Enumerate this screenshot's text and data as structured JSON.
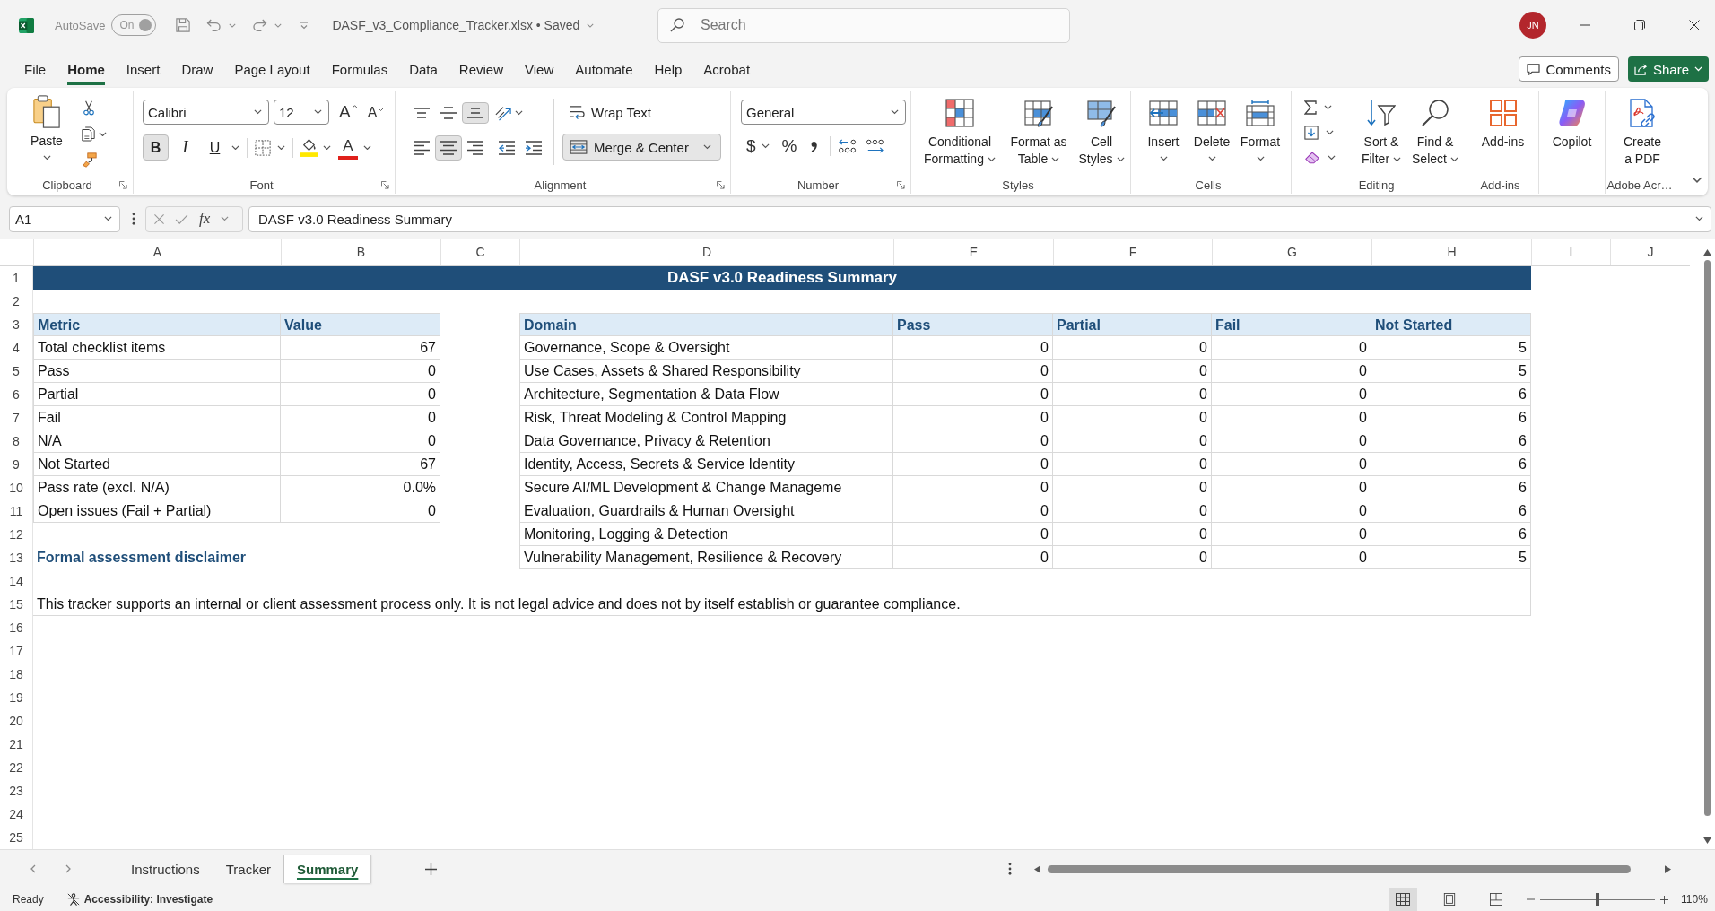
{
  "title_bar": {
    "autosave": {
      "label": "AutoSave",
      "on": true,
      "state_text": "On"
    },
    "document": "DASF_v3_Compliance_Tracker.xlsx • Saved",
    "search": {
      "placeholder": "Search"
    },
    "avatar": "JN"
  },
  "menu_tabs": [
    {
      "label": "File",
      "selected": false
    },
    {
      "label": "Home",
      "selected": true
    },
    {
      "label": "Insert",
      "selected": false
    },
    {
      "label": "Draw",
      "selected": false
    },
    {
      "label": "Page Layout",
      "selected": false
    },
    {
      "label": "Formulas",
      "selected": false
    },
    {
      "label": "Data",
      "selected": false
    },
    {
      "label": "Review",
      "selected": false
    },
    {
      "label": "View",
      "selected": false
    },
    {
      "label": "Automate",
      "selected": false
    },
    {
      "label": "Help",
      "selected": false
    },
    {
      "label": "Acrobat",
      "selected": false
    }
  ],
  "actions": {
    "comments": "Comments",
    "share": "Share"
  },
  "ribbon": {
    "clipboard": {
      "label": "Clipboard",
      "paste": "Paste"
    },
    "font": {
      "label": "Font",
      "name": "Calibri",
      "size": "12",
      "grow": "A",
      "shrink": "A",
      "styles": [
        {
          "kind": "bold",
          "text": "B",
          "selected": true
        },
        {
          "kind": "italic",
          "text": "I",
          "selected": false
        },
        {
          "kind": "underline",
          "text": "U",
          "selected": false
        }
      ],
      "font_color": "A"
    },
    "alignment": {
      "label": "Alignment",
      "vertical": [
        {
          "kind": "top",
          "selected": false
        },
        {
          "kind": "middle",
          "selected": false
        },
        {
          "kind": "bottom",
          "selected": true
        }
      ],
      "horizontal": [
        {
          "kind": "left",
          "selected": false
        },
        {
          "kind": "center",
          "selected": true
        },
        {
          "kind": "right",
          "selected": false
        }
      ],
      "wrap_text": {
        "label": "Wrap Text",
        "selected": false
      },
      "merge": {
        "label": "Merge & Center",
        "selected": true
      }
    },
    "number": {
      "label": "Number",
      "format": "General",
      "currency": "$",
      "percent": "%"
    },
    "styles": {
      "label": "Styles",
      "buttons": [
        {
          "kind": "conditional",
          "lines": [
            "Conditional",
            "Formatting"
          ]
        },
        {
          "kind": "table",
          "lines": [
            "Format as",
            "Table"
          ]
        },
        {
          "kind": "cell",
          "lines": [
            "Cell",
            "Styles"
          ]
        }
      ]
    },
    "cells": {
      "label": "Cells",
      "buttons": [
        {
          "kind": "insert",
          "label": "Insert"
        },
        {
          "kind": "delete",
          "label": "Delete"
        },
        {
          "kind": "format",
          "label": "Format"
        }
      ]
    },
    "editing": {
      "label": "Editing",
      "buttons": [
        {
          "kind": "sort",
          "lines": [
            "Sort &",
            "Filter"
          ]
        },
        {
          "kind": "find",
          "lines": [
            "Find &",
            "Select"
          ]
        }
      ]
    },
    "addins": {
      "label": "Add-ins",
      "button": "Add-ins"
    },
    "copilot": {
      "button": "Copilot"
    },
    "adobe": {
      "label": "Adobe Acr…",
      "lines": [
        "Create",
        "a PDF"
      ]
    }
  },
  "formula_bar": {
    "cell": "A1",
    "fx": "fx",
    "formula": "DASF v3.0 Readiness Summary"
  },
  "sheet": {
    "columns": [
      "A",
      "B",
      "C",
      "D",
      "E",
      "F",
      "G",
      "H",
      "I",
      "J"
    ],
    "rows": [
      "1",
      "2",
      "3",
      "4",
      "5",
      "6",
      "7",
      "8",
      "9",
      "10",
      "11",
      "12",
      "13",
      "14",
      "15",
      "16",
      "17",
      "18",
      "19",
      "20",
      "21",
      "22",
      "23",
      "24",
      "25"
    ],
    "title": "DASF v3.0 Readiness Summary",
    "metrics": {
      "columns": [
        "Metric",
        "Value"
      ],
      "rows": [
        [
          "Total checklist items",
          "67"
        ],
        [
          "Pass",
          "0"
        ],
        [
          "Partial",
          "0"
        ],
        [
          "Fail",
          "0"
        ],
        [
          "N/A",
          "0"
        ],
        [
          "Not Started",
          "67"
        ],
        [
          "Pass rate (excl. N/A)",
          "0.0%"
        ],
        [
          "Open issues (Fail + Partial)",
          "0"
        ]
      ]
    },
    "domains": {
      "columns": [
        "Domain",
        "Pass",
        "Partial",
        "Fail",
        "Not Started"
      ],
      "rows": [
        [
          "Governance, Scope & Oversight",
          "0",
          "0",
          "0",
          "5"
        ],
        [
          "Use Cases, Assets & Shared Responsibility",
          "0",
          "0",
          "0",
          "5"
        ],
        [
          "Architecture, Segmentation & Data Flow",
          "0",
          "0",
          "0",
          "6"
        ],
        [
          "Risk, Threat Modeling & Control Mapping",
          "0",
          "0",
          "0",
          "6"
        ],
        [
          "Data Governance, Privacy & Retention",
          "0",
          "0",
          "0",
          "6"
        ],
        [
          "Identity, Access, Secrets & Service Identity",
          "0",
          "0",
          "0",
          "6"
        ],
        [
          "Secure AI/ML Development & Change Manageme",
          "0",
          "0",
          "0",
          "6"
        ],
        [
          "Evaluation, Guardrails & Human Oversight",
          "0",
          "0",
          "0",
          "6"
        ],
        [
          "Monitoring, Logging & Detection",
          "0",
          "0",
          "0",
          "6"
        ],
        [
          "Vulnerability Management, Resilience & Recovery",
          "0",
          "0",
          "0",
          "5"
        ]
      ]
    },
    "disclaimer_heading": "Formal assessment disclaimer",
    "disclaimer": "This tracker supports an internal or client assessment process only. It is not legal advice and does not by itself establish or guarantee compliance."
  },
  "sheet_tabs": [
    {
      "label": "Instructions",
      "selected": false
    },
    {
      "label": "Tracker",
      "selected": false
    },
    {
      "label": "Summary",
      "selected": true
    }
  ],
  "status_bar": {
    "status": "Ready",
    "accessibility": "Accessibility: Investigate",
    "views": [
      {
        "kind": "normal",
        "selected": true
      },
      {
        "kind": "page_layout",
        "selected": false
      },
      {
        "kind": "page_break",
        "selected": false
      }
    ],
    "zoom": {
      "level": 0.5,
      "text": "110%"
    }
  }
}
